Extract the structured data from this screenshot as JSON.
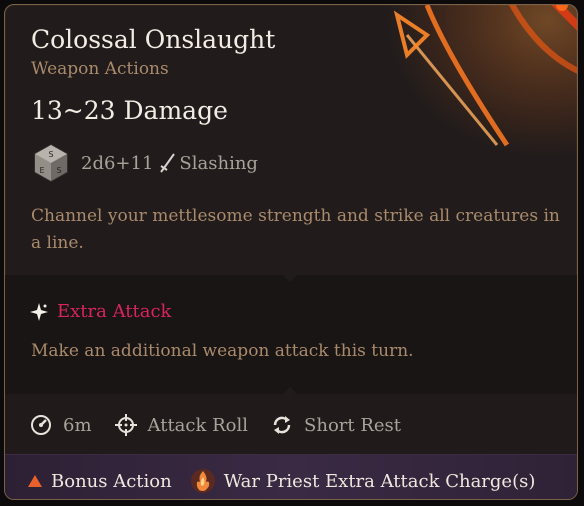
{
  "tooltip": {
    "title": "Colossal Onslaught",
    "subtitle": "Weapon Actions",
    "damage": "13~23 Damage",
    "dice": {
      "icon": "d6-dice-icon",
      "formula": "2d6+11",
      "type_icon": "sword-icon",
      "type": "Slashing"
    },
    "description": "Channel your mettlesome strength and strike all creatures in a line.",
    "extra_attack": {
      "icon": "sparkle-icon",
      "label": "Extra Attack",
      "description": "Make an additional weapon attack this turn."
    },
    "stats": [
      {
        "icon": "range-icon",
        "label": "6m"
      },
      {
        "icon": "crosshair-icon",
        "label": "Attack Roll"
      },
      {
        "icon": "recharge-icon",
        "label": "Short Rest"
      }
    ],
    "costs": [
      {
        "icon": "bonus-action-triangle-icon",
        "label": "Bonus Action"
      },
      {
        "icon": "war-priest-charge-icon",
        "label": "War Priest Extra Attack Charge(s)"
      }
    ]
  },
  "colors": {
    "title": "#f3ece4",
    "subtitle": "#a98a6c",
    "extra_attack": "#d8245a",
    "border": "#7a6248",
    "glow": "#ff6a1a"
  }
}
